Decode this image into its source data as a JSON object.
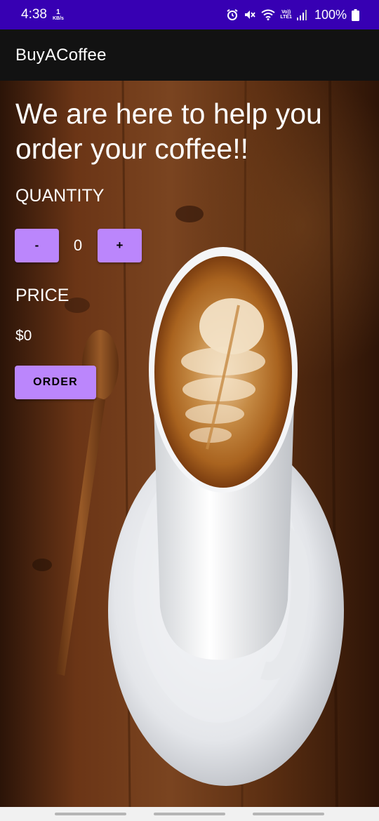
{
  "status_bar": {
    "time": "4:38",
    "net_speed_value": "1",
    "net_speed_unit": "KB/s",
    "volte_top": "Vo))",
    "volte_bottom": "LTE1",
    "battery": "100%",
    "icons": [
      "alarm-icon",
      "mute-icon",
      "wifi-icon",
      "volte-icon",
      "signal-icon",
      "battery-icon"
    ]
  },
  "app_bar": {
    "title": "BuyACoffee"
  },
  "main": {
    "headline": "We are here to help you order your coffee!!",
    "quantity_label": "QUANTITY",
    "decrement_label": "-",
    "quantity_value": "0",
    "increment_label": "+",
    "price_label": "PRICE",
    "price_value": "$0",
    "order_label": "ORDER"
  },
  "colors": {
    "status_bar": "#3700b3",
    "app_bar": "#121212",
    "button": "#bb86fc"
  }
}
